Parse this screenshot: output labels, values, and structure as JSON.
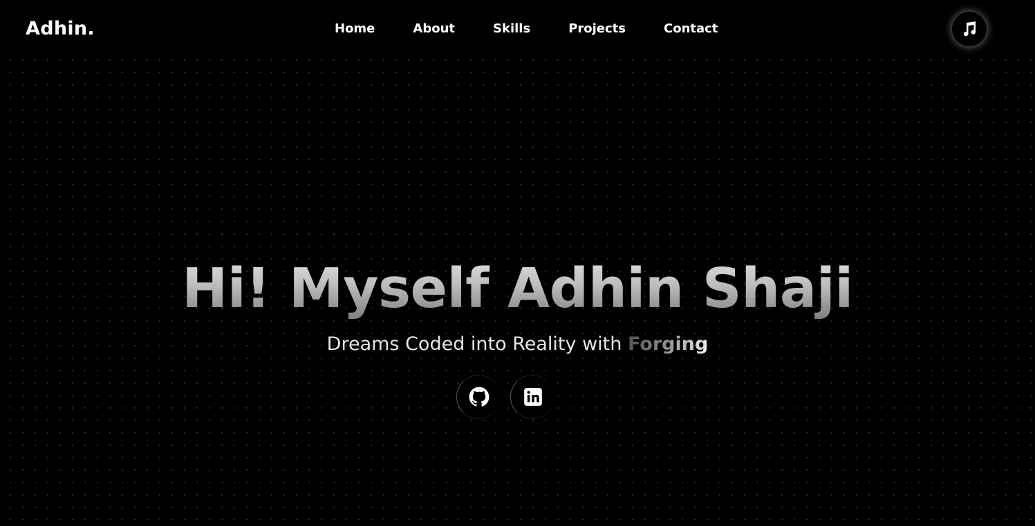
{
  "brand": {
    "logo": "Adhin."
  },
  "nav": {
    "items": [
      {
        "label": "Home"
      },
      {
        "label": "About"
      },
      {
        "label": "Skills"
      },
      {
        "label": "Projects"
      },
      {
        "label": "Contact"
      }
    ]
  },
  "header": {
    "music_icon": "music-note-icon"
  },
  "hero": {
    "title": "Hi! Myself Adhin Shaji",
    "tagline_prefix": "Dreams Coded into Reality with ",
    "tagline_typed": "Forging",
    "socials": [
      {
        "icon": "github-icon"
      },
      {
        "icon": "linkedin-icon"
      }
    ]
  },
  "colors": {
    "background": "#000000",
    "text": "#ffffff"
  }
}
